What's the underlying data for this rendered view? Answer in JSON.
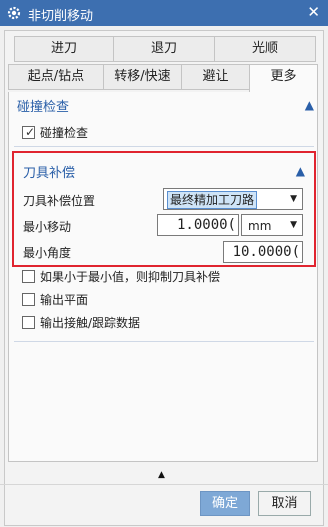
{
  "window": {
    "title": "非切削移动",
    "close_glyph": "✕",
    "icon": "gear-icon"
  },
  "tabs": {
    "row1": [
      "进刀",
      "退刀",
      "光顺"
    ],
    "row2": [
      "起点/钻点",
      "转移/快速",
      "避让",
      "更多"
    ],
    "active": "更多"
  },
  "collision": {
    "header": "碰撞检查",
    "checkbox_label": "碰撞检查",
    "checked": true
  },
  "cutter_comp": {
    "header": "刀具补偿",
    "position_label": "刀具补偿位置",
    "position_value": "最终精加工刀路",
    "min_move_label": "最小移动",
    "min_move_value": "1.0000(",
    "min_move_unit": "mm",
    "min_angle_label": "最小角度",
    "min_angle_value": "10.0000("
  },
  "options": [
    {
      "label": "如果小于最小值，则抑制刀具补偿",
      "checked": false
    },
    {
      "label": "输出平面",
      "checked": false
    },
    {
      "label": "输出接触/跟踪数据",
      "checked": false
    }
  ],
  "footer": {
    "ok_label": "确定",
    "cancel_label": "取消"
  },
  "colors": {
    "titlebar": "#3d6fb0",
    "accent": "#2a5fa8",
    "highlight": "#e0242f",
    "ok_button": "#7ea8d6"
  }
}
